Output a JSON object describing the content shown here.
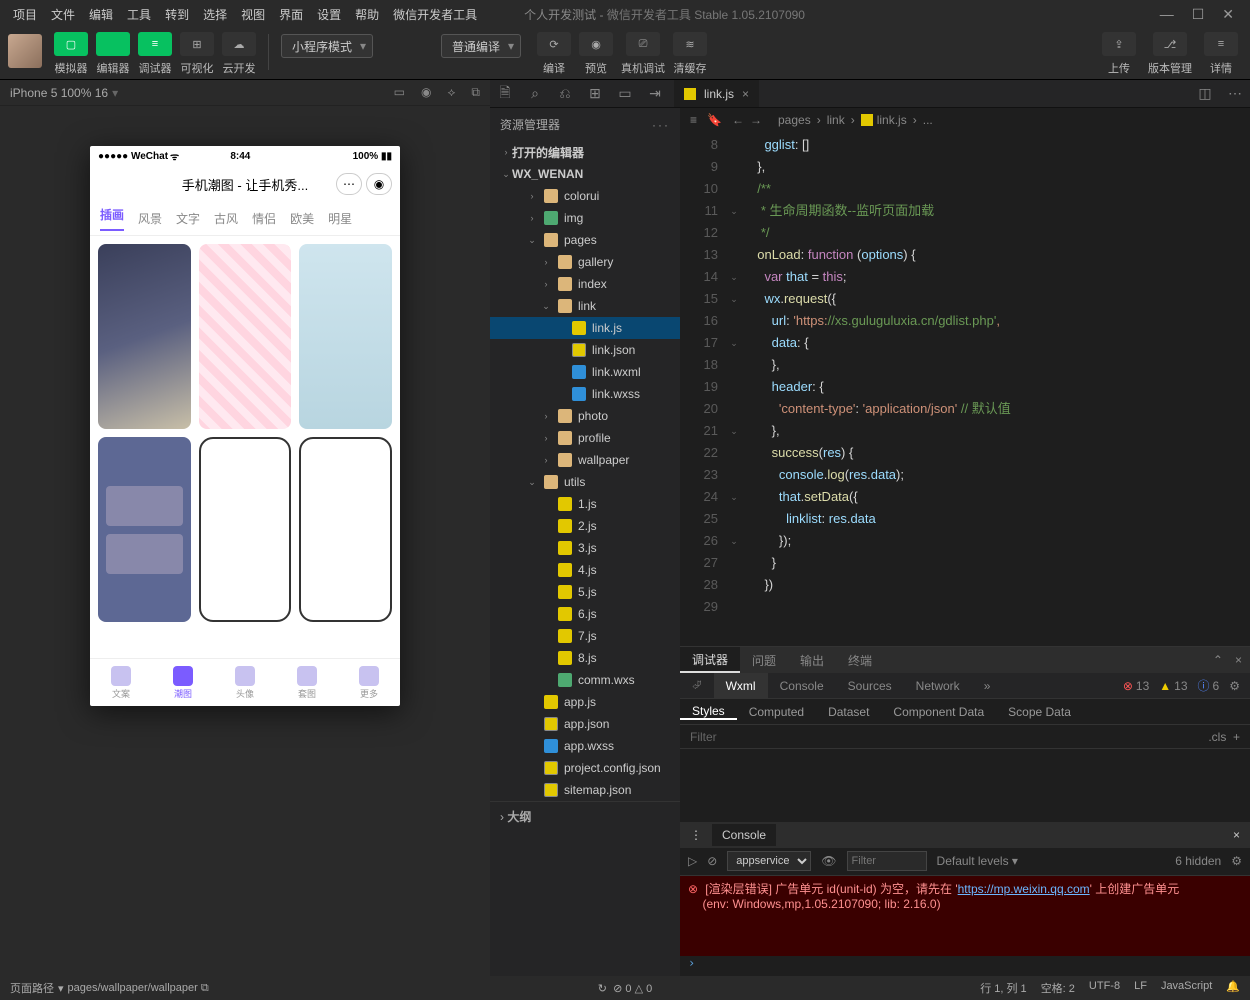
{
  "menu": {
    "items": [
      "项目",
      "文件",
      "编辑",
      "工具",
      "转到",
      "选择",
      "视图",
      "界面",
      "设置",
      "帮助",
      "微信开发者工具"
    ],
    "title": "个人开发测试",
    "title2": "微信开发者工具 Stable 1.05.2107090"
  },
  "toolbar": {
    "buttons": [
      {
        "label": "模拟器",
        "green": true,
        "glyph": "▢"
      },
      {
        "label": "编辑器",
        "green": true,
        "glyph": "</>"
      },
      {
        "label": "调试器",
        "green": true,
        "glyph": "≡"
      },
      {
        "label": "可视化",
        "green": false,
        "glyph": "⊞"
      },
      {
        "label": "云开发",
        "green": false,
        "glyph": "☁"
      }
    ],
    "mode": "小程序模式",
    "compile": "普通编译",
    "center": [
      {
        "label": "编译",
        "glyph": "⟳"
      },
      {
        "label": "预览",
        "glyph": "◉"
      },
      {
        "label": "真机调试",
        "glyph": "⎚"
      },
      {
        "label": "清缓存",
        "glyph": "≋"
      }
    ],
    "right": [
      {
        "label": "上传",
        "glyph": "⇪"
      },
      {
        "label": "版本管理",
        "glyph": "⎇"
      },
      {
        "label": "详情",
        "glyph": "≡"
      }
    ]
  },
  "sim": {
    "device": "iPhone 5 100% 16",
    "statusIcons": [
      "▭",
      "◉",
      "⟡",
      "⧉"
    ]
  },
  "phone": {
    "carrier": "●●●●● WeChat",
    "wifi": "ᯤ",
    "time": "8:44",
    "battery": "100%",
    "title": "手机潮图 - 让手机秀...",
    "tabs": [
      "插画",
      "风景",
      "文字",
      "古风",
      "情侣",
      "欧美",
      "明星"
    ],
    "nav": [
      {
        "label": "文案"
      },
      {
        "label": "潮图",
        "act": true
      },
      {
        "label": "头像"
      },
      {
        "label": "套图"
      },
      {
        "label": "更多"
      }
    ]
  },
  "explorer": {
    "title": "资源管理器",
    "sections": [
      "打开的编辑器",
      "WX_WENAN"
    ],
    "tree": [
      {
        "t": "colorui",
        "i": "fi-folder",
        "d": 2,
        "c": "›"
      },
      {
        "t": "img",
        "i": "fi-folder-img",
        "d": 2,
        "c": "›"
      },
      {
        "t": "pages",
        "i": "fi-folder-open",
        "d": 2,
        "c": "⌄"
      },
      {
        "t": "gallery",
        "i": "fi-folder",
        "d": 3,
        "c": "›"
      },
      {
        "t": "index",
        "i": "fi-folder",
        "d": 3,
        "c": "›"
      },
      {
        "t": "link",
        "i": "fi-folder-open",
        "d": 3,
        "c": "⌄"
      },
      {
        "t": "link.js",
        "i": "fi-js",
        "d": 4,
        "sel": true
      },
      {
        "t": "link.json",
        "i": "fi-json",
        "d": 4
      },
      {
        "t": "link.wxml",
        "i": "fi-wxml",
        "d": 4
      },
      {
        "t": "link.wxss",
        "i": "fi-wxss",
        "d": 4
      },
      {
        "t": "photo",
        "i": "fi-folder",
        "d": 3,
        "c": "›"
      },
      {
        "t": "profile",
        "i": "fi-folder",
        "d": 3,
        "c": "›"
      },
      {
        "t": "wallpaper",
        "i": "fi-folder",
        "d": 3,
        "c": "›"
      },
      {
        "t": "utils",
        "i": "fi-folder-open",
        "d": 2,
        "c": "⌄"
      },
      {
        "t": "1.js",
        "i": "fi-js",
        "d": 3
      },
      {
        "t": "2.js",
        "i": "fi-js",
        "d": 3
      },
      {
        "t": "3.js",
        "i": "fi-js",
        "d": 3
      },
      {
        "t": "4.js",
        "i": "fi-js",
        "d": 3
      },
      {
        "t": "5.js",
        "i": "fi-js",
        "d": 3
      },
      {
        "t": "6.js",
        "i": "fi-js",
        "d": 3
      },
      {
        "t": "7.js",
        "i": "fi-js",
        "d": 3
      },
      {
        "t": "8.js",
        "i": "fi-js",
        "d": 3
      },
      {
        "t": "comm.wxs",
        "i": "fi-wxs",
        "d": 3
      },
      {
        "t": "app.js",
        "i": "fi-js",
        "d": 2
      },
      {
        "t": "app.json",
        "i": "fi-json",
        "d": 2
      },
      {
        "t": "app.wxss",
        "i": "fi-wxss",
        "d": 2
      },
      {
        "t": "project.config.json",
        "i": "fi-json",
        "d": 2
      },
      {
        "t": "sitemap.json",
        "i": "fi-json",
        "d": 2
      }
    ],
    "outline": "大纲"
  },
  "editor": {
    "tab": "link.js",
    "breadcrumb": [
      "pages",
      "link",
      "link.js",
      "..."
    ],
    "startLine": 8,
    "lines": [
      "    gglist: []",
      "  },",
      "",
      "  /**",
      "   * 生命周期函数--监听页面加载",
      "   */",
      "  onLoad: function (options) {",
      "    var that = this;",
      "    wx.request({",
      "      url: 'https://xs.guluguluxia.cn/gdlist.php',",
      "      data: {",
      "      },",
      "      header: {",
      "        'content-type': 'application/json' // 默认值",
      "      },",
      "      success(res) {",
      "        console.log(res.data);",
      "        that.setData({",
      "          linklist: res.data",
      "        });",
      "      }",
      "    })"
    ],
    "folds": {
      "3": "⌄",
      "6": "⌄",
      "7": "⌄",
      "9": "⌄",
      "13": "⌄",
      "16": "⌄",
      "18": "⌄"
    }
  },
  "devtools": {
    "topTabs": [
      "调试器",
      "问题",
      "输出",
      "终端"
    ],
    "panelTabs": [
      "Wxml",
      "Console",
      "Sources",
      "Network"
    ],
    "warn": "13",
    "err": "13",
    "info": "6",
    "styleTabs": [
      "Styles",
      "Computed",
      "Dataset",
      "Component Data",
      "Scope Data"
    ],
    "filter": "Filter",
    "cls": ".cls",
    "console": {
      "title": "Console",
      "context": "appservice",
      "filterPlaceholder": "Filter",
      "levels": "Default levels",
      "hidden": "6 hidden",
      "error1": "[渲染层错误] 广告单元 id(unit-id) 为空，请先在 '",
      "errorLink": "https://mp.weixin.qq.com",
      "error1b": "' 上创建广告单元",
      "error2": "(env: Windows,mp,1.05.2107090; lib: 2.16.0)"
    }
  },
  "footer": {
    "left": "页面路径",
    "path": "pages/wallpaper/wallpaper",
    "circ": "⊘ 0 △ 0",
    "right": [
      "行 1, 列 1",
      "空格: 2",
      "UTF-8",
      "LF",
      "JavaScript"
    ]
  }
}
